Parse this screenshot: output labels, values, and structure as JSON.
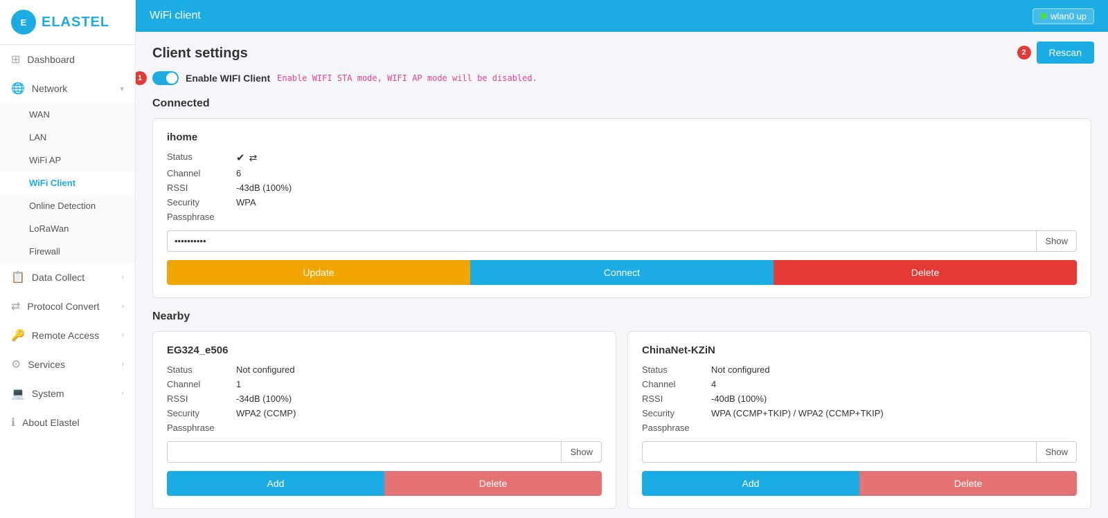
{
  "sidebar": {
    "logo_text": "ELASTEL",
    "items": [
      {
        "id": "dashboard",
        "label": "Dashboard",
        "icon": "⊞",
        "hasArrow": false,
        "children": []
      },
      {
        "id": "network",
        "label": "Network",
        "icon": "🔗",
        "hasArrow": true,
        "children": [
          {
            "id": "wan",
            "label": "WAN"
          },
          {
            "id": "lan",
            "label": "LAN"
          },
          {
            "id": "wifiap",
            "label": "WiFi AP"
          },
          {
            "id": "wificlient",
            "label": "WiFi Client",
            "active": true
          },
          {
            "id": "onlinedetection",
            "label": "Online Detection"
          },
          {
            "id": "lorawan",
            "label": "LoRaWan"
          },
          {
            "id": "firewall",
            "label": "Firewall"
          }
        ]
      },
      {
        "id": "datacollect",
        "label": "Data Collect",
        "icon": "📊",
        "hasArrow": true,
        "children": []
      },
      {
        "id": "protocolconvert",
        "label": "Protocol Convert",
        "icon": "⇄",
        "hasArrow": true,
        "children": []
      },
      {
        "id": "remoteaccess",
        "label": "Remote Access",
        "icon": "🔑",
        "hasArrow": true,
        "children": []
      },
      {
        "id": "services",
        "label": "Services",
        "icon": "⚙",
        "hasArrow": true,
        "children": []
      },
      {
        "id": "system",
        "label": "System",
        "icon": "💻",
        "hasArrow": true,
        "children": []
      },
      {
        "id": "aboutelastel",
        "label": "About Elastel",
        "icon": "ℹ",
        "hasArrow": false,
        "children": []
      }
    ]
  },
  "topbar": {
    "title": "WiFi client",
    "wifi_label": "wlan0 up"
  },
  "page": {
    "title": "Client settings",
    "enable_label": "Enable WIFI Client",
    "enable_note": "Enable WIFI STA mode, WIFI AP mode will be disabled.",
    "connected_title": "Connected",
    "nearby_title": "Nearby",
    "badge1": "1",
    "badge2": "2"
  },
  "connected_network": {
    "name": "ihome",
    "status_text": "",
    "channel": "6",
    "rssi": "-43dB (100%)",
    "security": "WPA",
    "passphrase_placeholder": "••••••••••",
    "show_label": "Show",
    "btn_update": "Update",
    "btn_connect": "Connect",
    "btn_delete": "Delete"
  },
  "nearby_networks": [
    {
      "id": "eg324",
      "name": "EG324_e506",
      "status": "Not configured",
      "channel": "1",
      "rssi": "-34dB (100%)",
      "security": "WPA2 (CCMP)",
      "btn_add": "Add",
      "btn_delete": "Delete"
    },
    {
      "id": "chinanet",
      "name": "ChinaNet-KZiN",
      "status": "Not configured",
      "channel": "4",
      "rssi": "-40dB (100%)",
      "security": "WPA (CCMP+TKIP) / WPA2 (CCMP+TKIP)",
      "btn_add": "Add",
      "btn_delete": "Delete"
    }
  ],
  "labels": {
    "status": "Status",
    "channel": "Channel",
    "rssi": "RSSI",
    "security": "Security",
    "passphrase": "Passphrase",
    "show": "Show",
    "rescan": "Rescan"
  }
}
